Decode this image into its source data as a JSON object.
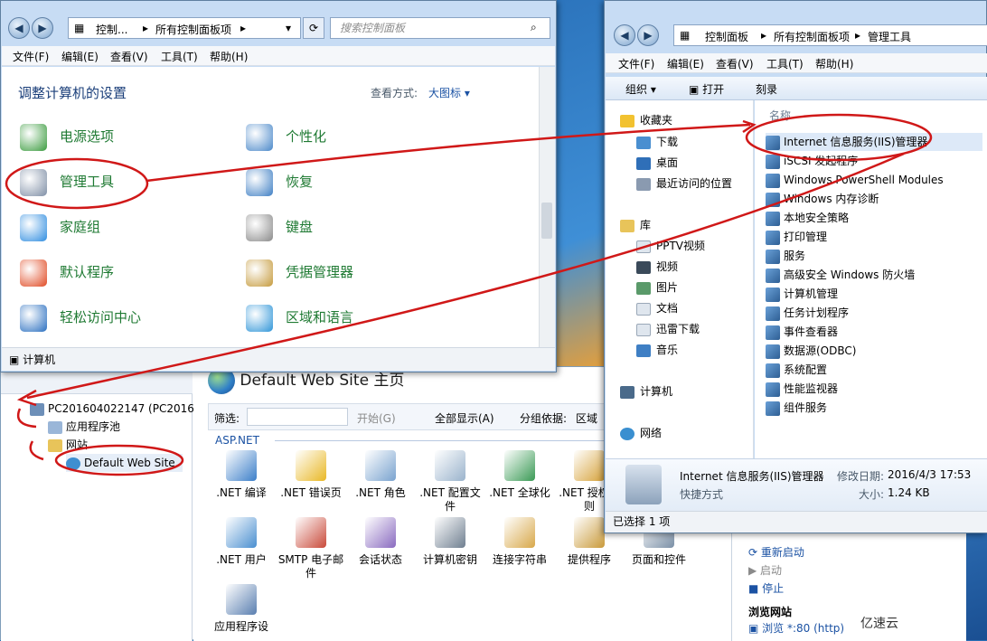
{
  "cp": {
    "breadcrumb": [
      "控制...",
      "所有控制面板项"
    ],
    "search_placeholder": "搜索控制面板",
    "menu": [
      "文件(F)",
      "编辑(E)",
      "查看(V)",
      "工具(T)",
      "帮助(H)"
    ],
    "heading": "调整计算机的设置",
    "view_label": "查看方式:",
    "view_value": "大图标 ▾",
    "items": [
      {
        "label": "电源选项",
        "icon": "battery-icon",
        "color": "#3a9b3e"
      },
      {
        "label": "个性化",
        "icon": "monitor-icon",
        "color": "#4a88c9"
      },
      {
        "label": "管理工具",
        "icon": "gears-icon",
        "color": "#7f8fa6"
      },
      {
        "label": "恢复",
        "icon": "restore-icon",
        "color": "#3f7fc4"
      },
      {
        "label": "家庭组",
        "icon": "homegroup-icon",
        "color": "#2f8de0"
      },
      {
        "label": "键盘",
        "icon": "keyboard-icon",
        "color": "#8a8a8a"
      },
      {
        "label": "默认程序",
        "icon": "default-programs-icon",
        "color": "#e04a24"
      },
      {
        "label": "凭据管理器",
        "icon": "vault-icon",
        "color": "#c59a3c"
      },
      {
        "label": "轻松访问中心",
        "icon": "ease-of-access-icon",
        "color": "#2a6fc0"
      },
      {
        "label": "区域和语言",
        "icon": "globe-icon",
        "color": "#2f95d8"
      }
    ],
    "status": "计算机"
  },
  "ex": {
    "breadcrumb": [
      "控制面板",
      "所有控制面板项",
      "管理工具"
    ],
    "menu": [
      "文件(F)",
      "编辑(E)",
      "查看(V)",
      "工具(T)",
      "帮助(H)"
    ],
    "toolbar": [
      "组织 ▾",
      "打开",
      "刻录"
    ],
    "nav": [
      "收藏夹",
      "下载",
      "桌面",
      "最近访问的位置",
      "库",
      "PPTV视频",
      "视频",
      "图片",
      "文档",
      "迅雷下载",
      "音乐",
      "计算机",
      "网络"
    ],
    "column_header": "名称",
    "files": [
      "Internet 信息服务(IIS)管理器",
      "iSCSI 发起程序",
      "Windows PowerShell Modules",
      "Windows 内存诊断",
      "本地安全策略",
      "打印管理",
      "服务",
      "高级安全 Windows 防火墙",
      "计算机管理",
      "任务计划程序",
      "事件查看器",
      "数据源(ODBC)",
      "系统配置",
      "性能监视器",
      "组件服务"
    ],
    "detail_name": "Internet 信息服务(IIS)管理器",
    "detail_type": "快捷方式",
    "detail_modified_label": "修改日期:",
    "detail_modified": "2016/4/3 17:53",
    "detail_size_label": "大小:",
    "detail_size": "1.24 KB",
    "status": "已选择 1 项"
  },
  "iis": {
    "title": "Default Web Site 主页",
    "tree": [
      "PC201604022147 (PC20160",
      "应用程序池",
      "网站",
      "Default Web Site"
    ],
    "filter_label": "筛选:",
    "start_label": "开始(G)",
    "show_all_label": "全部显示(A)",
    "group_label": "分组依据:",
    "group_value": "区域",
    "group_header": "ASP.NET",
    "features": [
      {
        "label": ".NET 编译",
        "color": "#3c7fc9"
      },
      {
        "label": ".NET 错误页",
        "color": "#e9b826"
      },
      {
        "label": ".NET 角色",
        "color": "#7aa3cf"
      },
      {
        "label": ".NET 配置文件",
        "color": "#9ab3cc"
      },
      {
        "label": ".NET 全球化",
        "color": "#3a9a55"
      },
      {
        "label": ".NET 授权规则",
        "color": "#d6a23a"
      },
      {
        "label": ".NET 用户",
        "color": "#4a8fd0"
      },
      {
        "label": "SMTP 电子邮件",
        "color": "#c94a3a"
      },
      {
        "label": "会话状态",
        "color": "#8a6bc0"
      },
      {
        "label": "计算机密钥",
        "color": "#6f7f90"
      },
      {
        "label": "连接字符串",
        "color": "#d8a84a"
      },
      {
        "label": "提供程序",
        "color": "#c99a3a"
      },
      {
        "label": "页面和控件",
        "color": "#7a8fa6"
      },
      {
        "label": "应用程序设",
        "color": "#5a7fb0"
      }
    ],
    "actions": [
      "重新启动",
      "启动",
      "停止"
    ],
    "browse_header": "浏览网站",
    "browse_link": "浏览 *:80 (http)"
  },
  "watermark": "亿速云",
  "annotation_color": "#d01818"
}
